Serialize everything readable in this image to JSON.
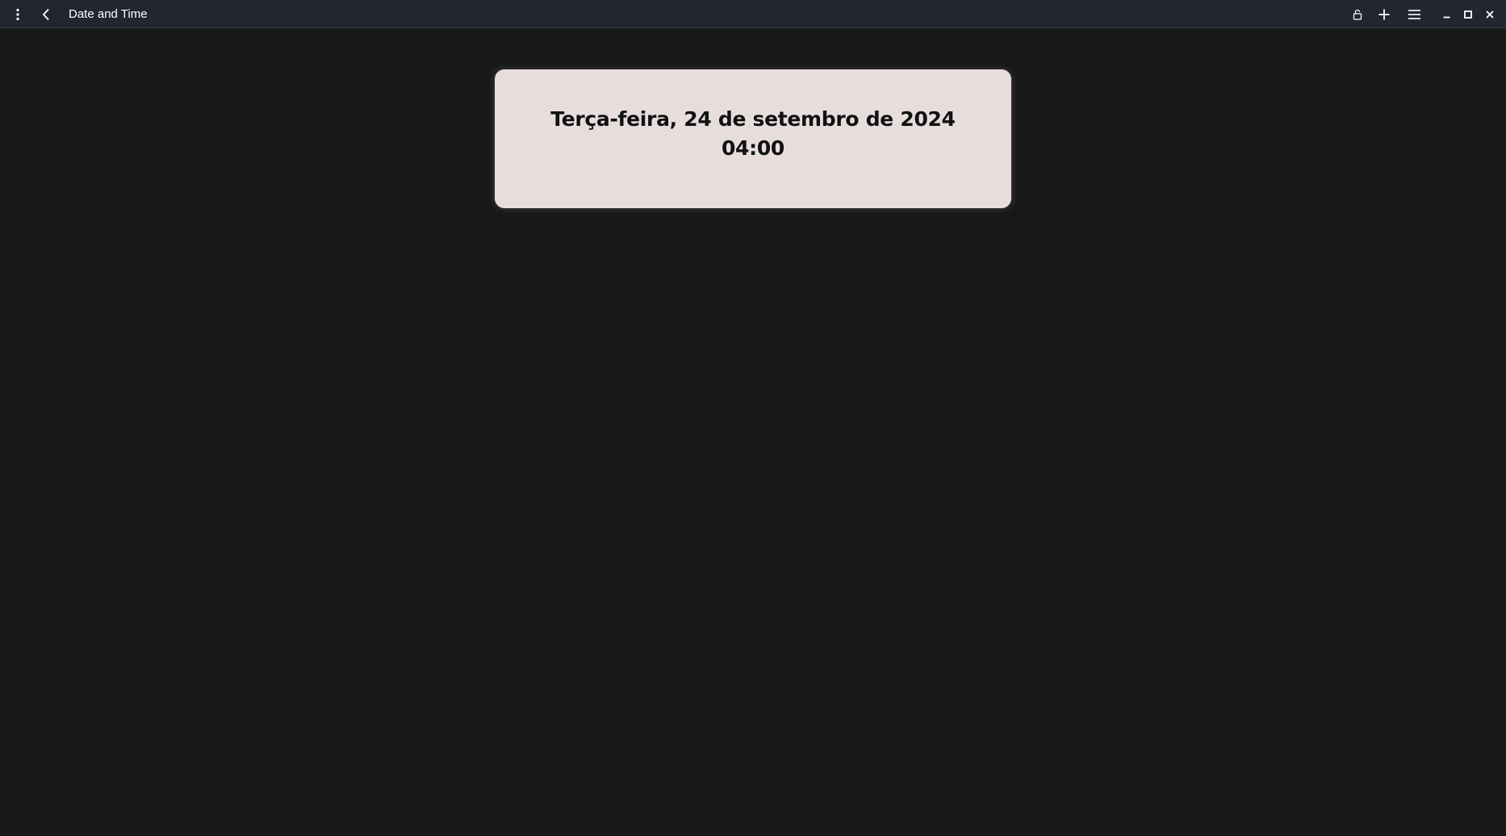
{
  "window": {
    "title": "Date and Time",
    "icons": {
      "menu": "kebab-menu-icon",
      "back": "chevron-left-icon",
      "lock": "lock-icon",
      "add": "plus-icon",
      "hamburger": "hamburger-menu-icon",
      "minimize": "minimize-icon",
      "maximize": "maximize-icon",
      "close": "close-icon"
    }
  },
  "card": {
    "date": "Terça-feira, 24 de setembro de 2024",
    "time": "04:00"
  },
  "colors": {
    "background": "#181818",
    "titlebar": "#222631",
    "card": "#e8dddd",
    "text": "#111111"
  }
}
